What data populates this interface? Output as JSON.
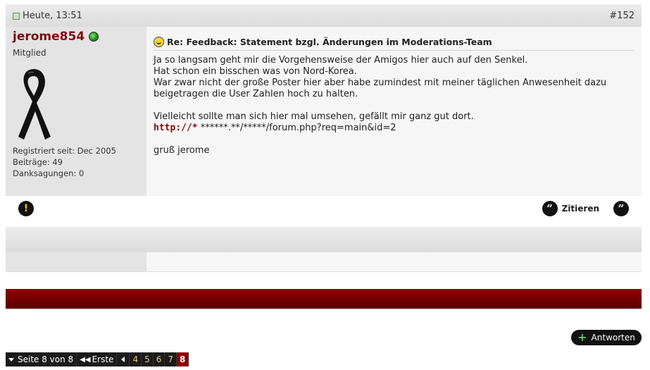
{
  "post": {
    "date": "Heute, 13:51",
    "number": "#152",
    "user": {
      "name": "jerome854",
      "title": "Mitglied",
      "registered": "Registriert seit: Dec 2005",
      "posts": "Beiträge: 49",
      "thanks": "Danksagungen: 0"
    },
    "title": "Re: Feedback: Statement bzgl. Änderungen im Moderations-Team",
    "lines": [
      "Ja so langsam geht mir die Vorgehensweise der Amigos hier auch auf den Senkel.",
      "Hat schon ein bisschen was von Nord-Korea.",
      "War zwar nicht der große Poster hier aber habe zumindest mit meiner täglichen Anwesenheit dazu",
      "beigetragen die User Zahlen hoch zu halten."
    ],
    "line_after": "Vielleicht sollte man sich hier mal umsehen, gefällt mir ganz gut dort.",
    "link_prefix": "http://*",
    "link_rest": " ******.**/*****/forum.php?req=main&id=2",
    "signoff": "gruß jerome",
    "quote_label": "Zitieren"
  },
  "reply_label": "Antworten",
  "pagination": {
    "label": "Seite 8 von 8",
    "first": "Erste",
    "pages": [
      "4",
      "5",
      "6",
      "7"
    ],
    "current": "8"
  },
  "colors": {
    "username": "#7a1010",
    "red_bar": "#6e0000",
    "online": "#1a8a16"
  }
}
